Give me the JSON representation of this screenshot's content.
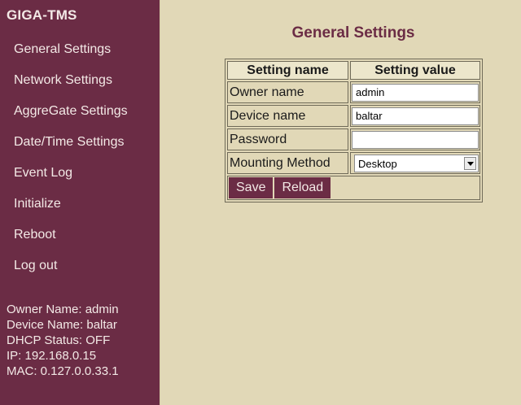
{
  "sidebar": {
    "brand": "GIGA-TMS",
    "nav": [
      {
        "label": "General Settings"
      },
      {
        "label": "Network Settings"
      },
      {
        "label": "AggreGate Settings"
      },
      {
        "label": "Date/Time Settings"
      },
      {
        "label": "Event Log"
      },
      {
        "label": "Initialize"
      },
      {
        "label": "Reboot"
      },
      {
        "label": "Log out"
      }
    ],
    "status": {
      "owner": "Owner Name: admin",
      "device": "Device Name: baltar",
      "dhcp": "DHCP Status: OFF",
      "ip": "IP: 192.168.0.15",
      "mac": "MAC: 0.127.0.0.33.1"
    }
  },
  "main": {
    "title": "General Settings",
    "table": {
      "headers": [
        "Setting name",
        "Setting value"
      ],
      "rows": [
        {
          "label": "Owner name",
          "value": "admin"
        },
        {
          "label": "Device name",
          "value": "baltar"
        },
        {
          "label": "Password",
          "value": ""
        },
        {
          "label": "Mounting Method",
          "value": "Desktop"
        }
      ]
    },
    "buttons": {
      "save": "Save",
      "reload": "Reload"
    }
  },
  "colors": {
    "sidebar_bg": "#6b2c45",
    "page_bg": "#e1d8b7",
    "title_color": "#6b2c45"
  }
}
